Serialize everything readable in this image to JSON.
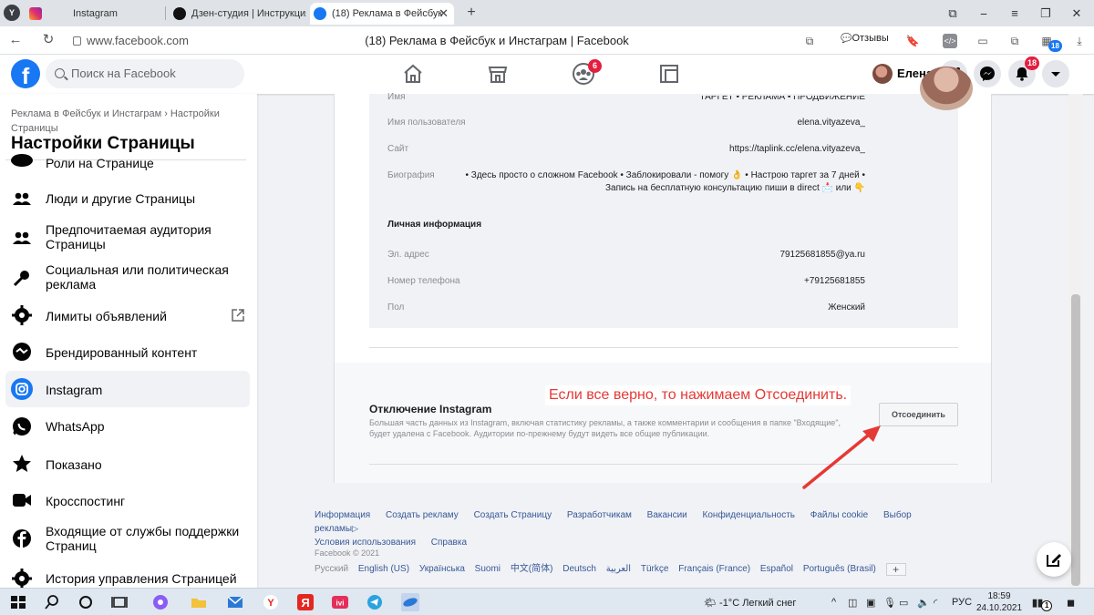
{
  "browser": {
    "tabs": [
      {
        "label": "Instagram"
      },
      {
        "label": "Дзен-студия | Инструкция"
      },
      {
        "label": "(18) Реклама в Фейсбук"
      }
    ],
    "url": "www.facebook.com",
    "page_title": "(18) Реклама в Фейсбук и Инстаграм | Facebook",
    "reviews_label": "Отзывы",
    "ext_badge": "18"
  },
  "fb_nav": {
    "search_placeholder": "Поиск на Facebook",
    "groups_badge": "6",
    "user_name": "Елена",
    "notifications_badge": "18"
  },
  "sidebar": {
    "breadcrumb": "Реклама в Фейсбук и Инстаграм › Настройки Страницы",
    "title": "Настройки Страницы",
    "items": [
      {
        "label": "Роли на Странице"
      },
      {
        "label": "Люди и другие Страницы"
      },
      {
        "label": "Предпочитаемая аудитория Страницы"
      },
      {
        "label": "Социальная или политическая реклама"
      },
      {
        "label": "Лимиты объявлений"
      },
      {
        "label": "Брендированный контент"
      },
      {
        "label": "Instagram"
      },
      {
        "label": "WhatsApp"
      },
      {
        "label": "Показано"
      },
      {
        "label": "Кросспостинг"
      },
      {
        "label": "Входящие от службы поддержки Страниц"
      },
      {
        "label": "История управления Страницей"
      }
    ]
  },
  "instagram_info": {
    "name_label": "Имя",
    "name_value": "ТАРГЕТ • РЕКЛАМА • ПРОДВИЖЕНИЕ",
    "username_label": "Имя пользователя",
    "username_value": "elena.vityazeva_",
    "site_label": "Сайт",
    "site_value": "https://taplink.cc/elena.vityazeva_",
    "bio_label": "Биография",
    "bio_value": "• Здесь просто о сложном Facebook • Заблокировали - помогу 👌 • Настрою таргет за 7 дней • Запись на бесплатную консультацию пиши в direct 📩 или 👇",
    "personal_heading": "Личная информация",
    "email_label": "Эл. адрес",
    "email_value": "79125681855@ya.ru",
    "phone_label": "Номер телефона",
    "phone_value": "+79125681855",
    "gender_label": "Пол",
    "gender_value": "Женский"
  },
  "disconnect": {
    "title": "Отключение Instagram",
    "text": "Большая часть данных из Instagram, включая статистику рекламы, а также комментарии и сообщения в папке \"Входящие\", будет удалена с Facebook. Аудитории по-прежнему будут видеть все общие публикации.",
    "button": "Отсоединить"
  },
  "annotation": "Если все верно, то нажимаем Отсоединить.",
  "footer": {
    "links": [
      "Информация",
      "Создать рекламу",
      "Создать Страницу",
      "Разработчикам",
      "Вакансии",
      "Конфиденциальность",
      "Файлы cookie",
      "Выбор рекламы",
      "Условия использования",
      "Справка"
    ],
    "copyright": "Facebook © 2021",
    "languages": [
      "Русский",
      "English (US)",
      "Українська",
      "Suomi",
      "中文(简体)",
      "Deutsch",
      "العربية",
      "Türkçe",
      "Français (France)",
      "Español",
      "Português (Brasil)"
    ],
    "more_languages": "+"
  },
  "taskbar": {
    "weather": "-1°C  Легкий снег",
    "lang": "РУС",
    "time": "18:59",
    "date": "24.10.2021",
    "notif_count": "1"
  },
  "colors": {
    "fb_blue": "#1877f2",
    "badge_red": "#e41e3f",
    "annotation_red": "#e53935",
    "link_blue": "#385898"
  }
}
